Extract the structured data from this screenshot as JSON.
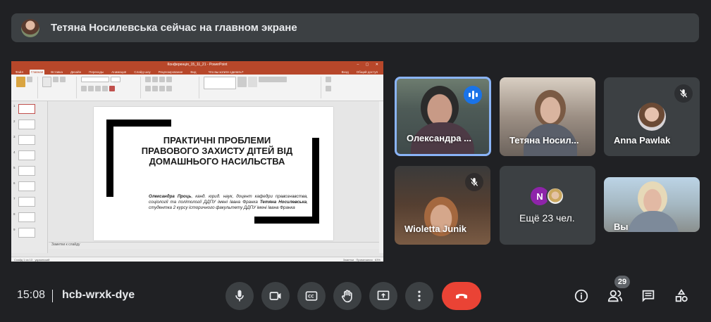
{
  "banner": {
    "text": "Тетяна Носилевська сейчас на главном экране"
  },
  "presentation": {
    "window_title": "Конференція_15_11_21 - PowerPoint",
    "tabs": [
      "Файл",
      "Главная",
      "Вставка",
      "Дизайн",
      "Переходы",
      "Анимация",
      "Слайд-шоу",
      "Рецензирование",
      "Вид"
    ],
    "search_hint": "Что вы хотите сделать?",
    "login": "Вход",
    "share": "Общий доступ",
    "slide_title": "ПРАКТИЧНІ ПРОБЛЕМИ ПРАВОВОГО ЗАХИСТУ ДІТЕЙ ВІД ДОМАШНЬОГО НАСИЛЬСТВА",
    "author1_name": "Олександра Проць",
    "author1_desc": ", канд. юрид. наук, доцент кафедри правознавства, соціології та політології ДДПУ імені Івана Франка",
    "author2_name": "Тетяна Носилевська",
    "author2_desc": ", студентка 2 курсу історичного факультету ДДПУ імені Івана Франка",
    "notes": "Заметки к слайду",
    "status_left": "Слайд 1 из 13",
    "status_lang": "украинский",
    "status_notes": "Заметки",
    "status_comments": "Примечания",
    "zoom": "63%"
  },
  "participants": [
    {
      "name": "Олександра ...",
      "speaking": true
    },
    {
      "name": "Тетяна Носил...",
      "speaking": false
    },
    {
      "name": "Anna Pawlak",
      "muted": true
    },
    {
      "name": "Wioletta Junik",
      "muted": true
    },
    {
      "name": "Ещё 23 чел.",
      "avatar_letter": "N"
    },
    {
      "name": "Вы"
    }
  ],
  "controls": {
    "time": "15:08",
    "meeting_code": "hcb-wrxk-dye",
    "participant_count": "29"
  },
  "colors": {
    "accent": "#8ab4f8",
    "end_call": "#ea4335",
    "speaking": "#1a73e8",
    "ppt_brand": "#b7472a"
  }
}
